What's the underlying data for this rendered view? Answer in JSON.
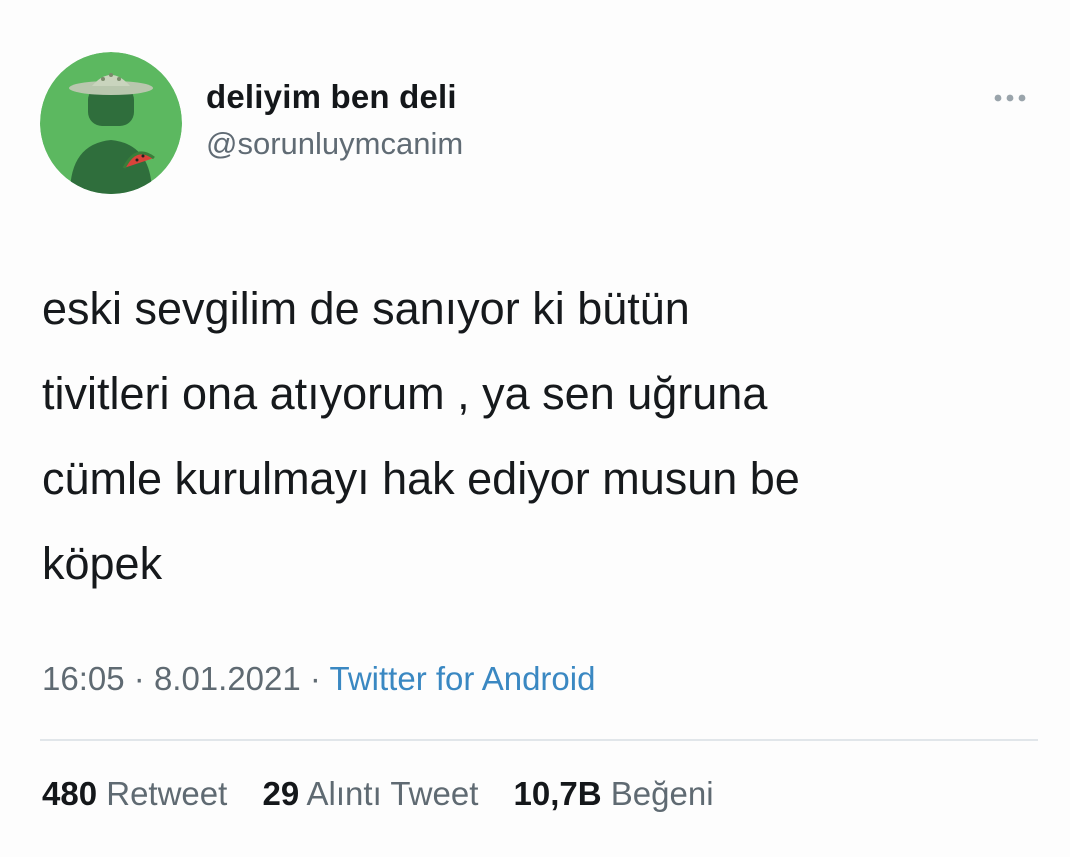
{
  "tweet": {
    "author": {
      "display_name": "deliyim ben deli",
      "handle": "@sorunluymcanim",
      "avatar_icon": "profile-avatar-icon",
      "avatar_bg": "#5cb860"
    },
    "more_icon": "more-options-icon",
    "text_lines": [
      "eski sevgilim de sanıyor ki bütün",
      "tivitleri ona atıyorum , ya sen uğruna",
      "cümle kurulmayı hak ediyor musun be",
      "köpek"
    ],
    "time": "16:05",
    "separator": "·",
    "date": "8.01.2021",
    "source": "Twitter for Android",
    "stats": [
      {
        "count": "480",
        "label": "Retweet"
      },
      {
        "count": "29",
        "label": "Alıntı Tweet"
      },
      {
        "count": "10,7B",
        "label": "Beğeni"
      }
    ]
  },
  "colors": {
    "link": "#3a88c2",
    "muted": "#5f6a72",
    "text": "#14171a",
    "divider": "#e1e6ea"
  }
}
